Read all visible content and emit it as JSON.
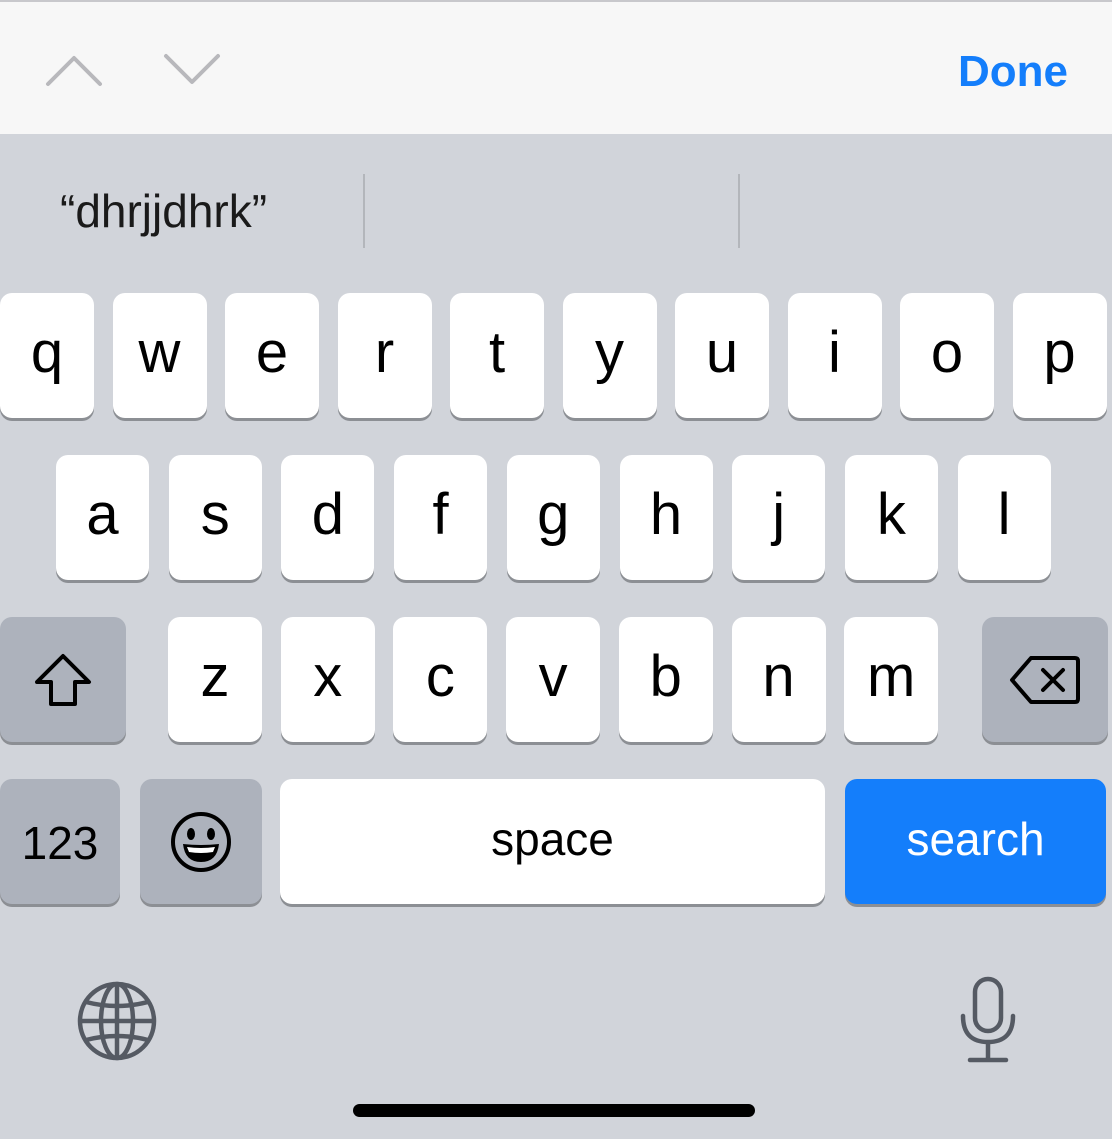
{
  "toolbar": {
    "prev_icon": "chevron-up-icon",
    "next_icon": "chevron-down-icon",
    "done_label": "Done",
    "done_color": "#147efb"
  },
  "predictive": {
    "suggestions": [
      "“dhrjjdhrk”",
      "",
      ""
    ]
  },
  "keyboard": {
    "row1": [
      "q",
      "w",
      "e",
      "r",
      "t",
      "y",
      "u",
      "i",
      "o",
      "p"
    ],
    "row2": [
      "a",
      "s",
      "d",
      "f",
      "g",
      "h",
      "j",
      "k",
      "l"
    ],
    "row3": [
      "z",
      "x",
      "c",
      "v",
      "b",
      "n",
      "m"
    ],
    "shift_icon": "shift-icon",
    "delete_icon": "delete-icon",
    "numbers_label": "123",
    "emoji_icon": "emoji-icon",
    "space_label": "space",
    "search_label": "search",
    "search_color": "#147efb",
    "globe_icon": "globe-icon",
    "mic_icon": "microphone-icon"
  },
  "colors": {
    "keyboard_bg": "#d1d4da",
    "key_bg": "#ffffff",
    "special_key_bg": "#adb2bc",
    "accent": "#147efb"
  }
}
